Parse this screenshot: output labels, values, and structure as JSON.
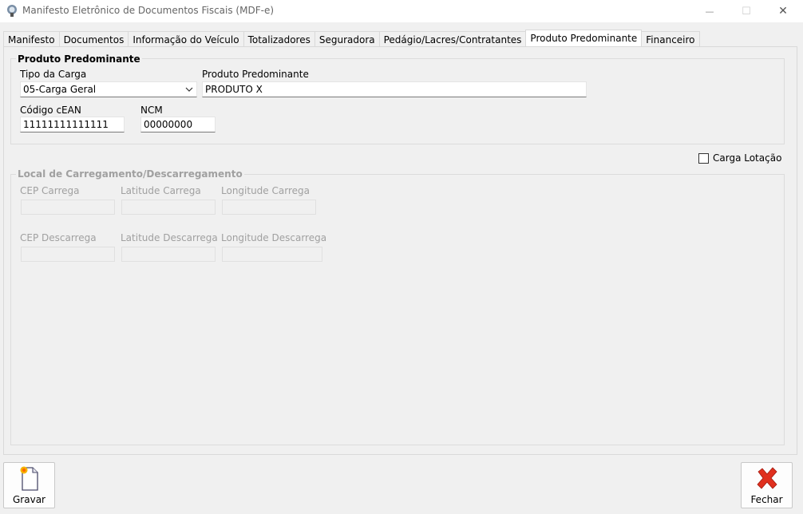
{
  "window": {
    "title": "Manifesto Eletrônico de Documentos Fiscais (MDF-e)",
    "minimize_glyph": "—",
    "maximize_glyph": "☐",
    "close_glyph": "✕"
  },
  "tabs": [
    {
      "label": "Manifesto"
    },
    {
      "label": "Documentos"
    },
    {
      "label": "Informação do Veículo"
    },
    {
      "label": "Totalizadores"
    },
    {
      "label": "Seguradora"
    },
    {
      "label": "Pedágio/Lacres/Contratantes"
    },
    {
      "label": "Produto Predominante",
      "active": true
    },
    {
      "label": "Financeiro"
    }
  ],
  "produto": {
    "group_title": "Produto Predominante",
    "tipo_carga_label": "Tipo da Carga",
    "tipo_carga_value": "05-Carga Geral",
    "produto_label": "Produto Predominante",
    "produto_value": "PRODUTO X",
    "cean_label": "Código cEAN",
    "cean_value": "11111111111111",
    "ncm_label": "NCM",
    "ncm_value": "00000000"
  },
  "carga_lotacao": {
    "label": "Carga Lotação",
    "checked": false
  },
  "local": {
    "group_title": "Local de Carregamento/Descarregamento",
    "cep_carrega_label": "CEP Carrega",
    "lat_carrega_label": "Latitude Carrega",
    "lon_carrega_label": "Longitude Carrega",
    "cep_descarrega_label": "CEP Descarrega",
    "lat_descarrega_label": "Latitude Descarrega",
    "lon_descarrega_label": "Longitude Descarrega",
    "cep_carrega_value": "",
    "lat_carrega_value": "",
    "lon_carrega_value": "",
    "cep_descarrega_value": "",
    "lat_descarrega_value": "",
    "lon_descarrega_value": ""
  },
  "buttons": {
    "gravar_label": "Gravar",
    "fechar_label": "Fechar"
  },
  "colors": {
    "close_x": "#e0301e",
    "disabled_text": "#a0a0a0"
  }
}
